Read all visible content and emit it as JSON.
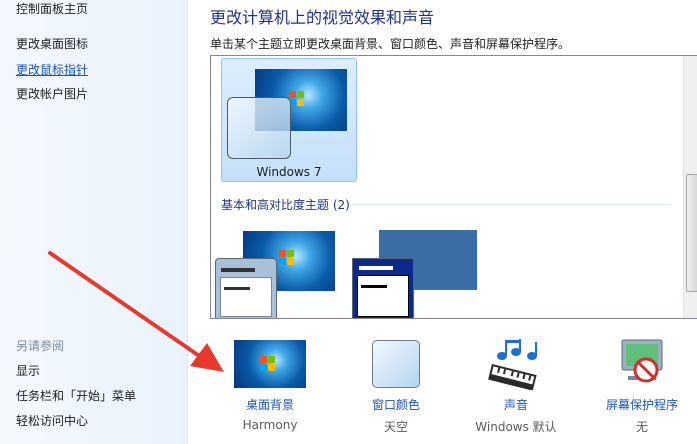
{
  "sidebar": {
    "home": "控制面板主页",
    "links": [
      "更改桌面图标",
      "更改鼠标指针",
      "更改帐户图片"
    ],
    "see_also_header": "另请参阅",
    "see_also_links": [
      "显示",
      "任务栏和「开始」菜单",
      "轻松访问中心"
    ]
  },
  "main": {
    "title": "更改计算机上的视觉效果和声音",
    "subtitle": "单击某个主题立即更改桌面背景、窗口颜色、声音和屏幕保护程序。",
    "themes": {
      "selected_theme": "Windows 7",
      "basic_group_label": "基本和高对比度主题 (2)"
    },
    "bottom": [
      {
        "label": "桌面背景",
        "value": "Harmony",
        "icon": "desktop-background-icon"
      },
      {
        "label": "窗口颜色",
        "value": "天空",
        "icon": "window-color-icon"
      },
      {
        "label": "声音",
        "value": "Windows 默认",
        "icon": "sound-icon"
      },
      {
        "label": "屏幕保护程序",
        "value": "无",
        "icon": "screensaver-icon"
      }
    ]
  },
  "colors": {
    "link": "#1a55b8",
    "title": "#1e3287",
    "selection": "#c5e0f9",
    "arrow": "#e8392f"
  }
}
